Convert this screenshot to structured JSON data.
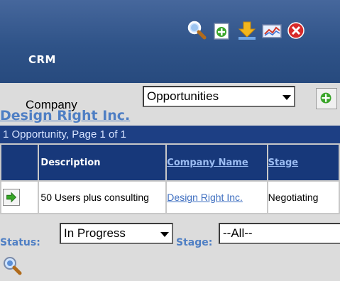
{
  "header": {
    "app_title": "CRM",
    "toolbar_icons": [
      "search-icon",
      "new-record-icon",
      "download-icon",
      "chart-icon",
      "close-icon"
    ]
  },
  "toolbar": {
    "company_label": "Company",
    "view_select": {
      "selected": "Opportunities"
    },
    "add_icon": "add-record-icon"
  },
  "company": {
    "name": "Design Right Inc."
  },
  "results": {
    "page_info": "1 Opportunity, Page 1 of 1"
  },
  "table": {
    "columns": {
      "description": "Description",
      "company_name": "Company Name",
      "stage": "Stage"
    },
    "rows": [
      {
        "description": "50 Users plus consulting",
        "company_name": "Design Right Inc.",
        "stage": "Negotiating"
      }
    ]
  },
  "filters": {
    "status_label": "Status:",
    "status_value": "In Progress",
    "stage_label": "Stage:",
    "stage_value": "--All--"
  },
  "colors": {
    "header_blue": "#2f5388",
    "table_header": "#17387a",
    "link_blue": "#3f6fc0"
  }
}
